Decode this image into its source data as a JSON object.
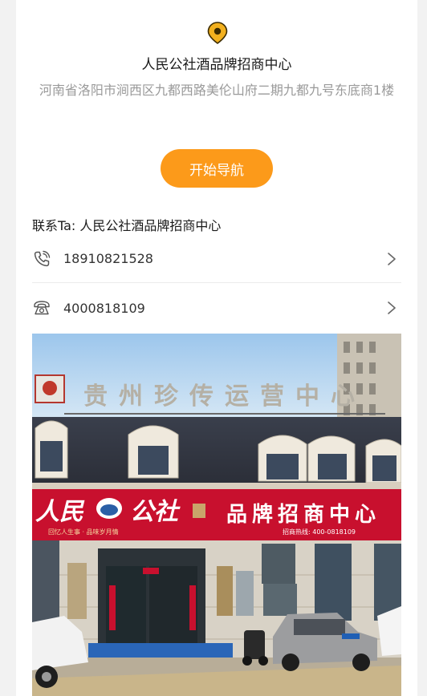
{
  "store": {
    "name": "人民公社酒品牌招商中心",
    "address": "河南省洛阳市涧西区九都西路美伦山府二期九都九号东底商1楼"
  },
  "navigation": {
    "button_label": "开始导航"
  },
  "contact": {
    "label": "联系Ta: 人民公社酒品牌招商中心",
    "phones": [
      {
        "number": "18910821528",
        "icon": "mobile-phone-icon"
      },
      {
        "number": "4000818109",
        "icon": "landline-phone-icon"
      }
    ]
  },
  "photo": {
    "rooftop_sign": "贵州珍传运营中心",
    "banner_left": "人民",
    "banner_brand": "公社",
    "banner_right": "品牌招商中心",
    "banner_slogan": "回忆人生事 · 品味岁月情",
    "banner_hotline": "招商热线: 400-0818109"
  },
  "colors": {
    "accent": "#fc9a1a",
    "banner_red": "#c8102e",
    "pin_yellow": "#f2b01e"
  }
}
